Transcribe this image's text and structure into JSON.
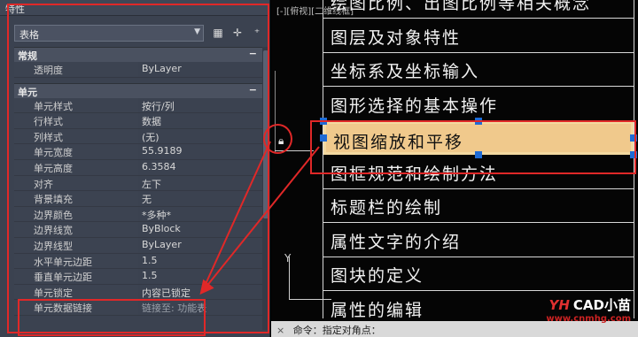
{
  "palette": {
    "title": "特性",
    "selector_value": "表格",
    "toolbar": {
      "quick_select_icon": "quick-select-icon",
      "pick_icon": "pick-object-icon",
      "toggle_icon": "toggle-pickadd-icon"
    },
    "sections": [
      {
        "label": "常规",
        "rows": [
          {
            "name": "透明度",
            "value": "ByLayer"
          }
        ]
      },
      {
        "label": "单元",
        "rows": [
          {
            "name": "单元样式",
            "value": "按行/列"
          },
          {
            "name": "行样式",
            "value": "数据"
          },
          {
            "name": "列样式",
            "value": "(无)"
          },
          {
            "name": "单元宽度",
            "value": "55.9189"
          },
          {
            "name": "单元高度",
            "value": "6.3584"
          },
          {
            "name": "对齐",
            "value": "左下"
          },
          {
            "name": "背景填充",
            "value": "无"
          },
          {
            "name": "边界颜色",
            "value": "*多种*"
          },
          {
            "name": "边界线宽",
            "value": "ByBlock"
          },
          {
            "name": "边界线型",
            "value": "ByLayer"
          },
          {
            "name": "水平单元边距",
            "value": "1.5"
          },
          {
            "name": "垂直单元边距",
            "value": "1.5"
          },
          {
            "name": "单元锁定",
            "value": "内容已锁定"
          },
          {
            "name": "单元数据链接",
            "value": "链接至: 功能表"
          }
        ]
      }
    ]
  },
  "canvas": {
    "view_label": "[-][俯视][二维线框]",
    "cells": [
      "绘图比例、出图比例等相关概念",
      "图层及对象特性",
      "坐标系及坐标输入",
      "图形选择的基本操作",
      "视图缩放和平移",
      "图框规范和绘制方法",
      "标题栏的绘制",
      "属性文字的介绍",
      "图块的定义",
      "属性的编辑"
    ],
    "selected_index": 4,
    "axis_y_label": "Y",
    "command_prompt": "命令：指定对角点："
  },
  "watermark": {
    "brand": "CAD小苗",
    "logo": "YH",
    "url": "www.cnmhg.com"
  },
  "colors": {
    "annotation_red": "#e02828",
    "selection_fill": "#f0c98c",
    "grip_blue": "#1f6bd6"
  }
}
